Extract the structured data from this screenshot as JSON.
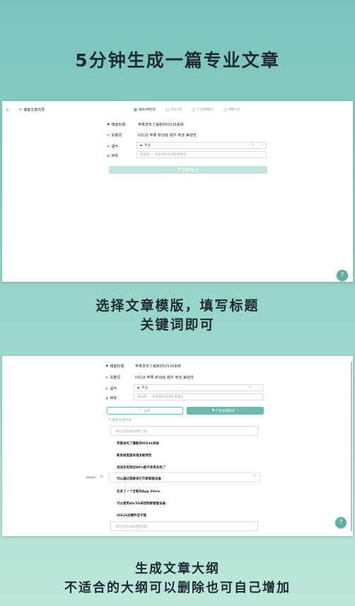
{
  "headline": "5分钟生成一篇专业文章",
  "caption1": [
    "选择文章模版，填写标题",
    "关键词即可"
  ],
  "caption2": [
    "生成文章大纲",
    "不适合的大纲可以删除也可自己增加"
  ],
  "panel1": {
    "logo": "C",
    "app_title": "博客文章向导",
    "steps": [
      "填选详细信息",
      "生成大纲",
      "产生段落要点",
      "博客内容"
    ],
    "fields": {
      "title_label": "博客标题",
      "title_value": "苹果发布了最新的IOS16系统",
      "keywords_label": "关键词",
      "keywords_value": "IOS16 苹果 新功能 组件 电池 兼容性",
      "tone_label": "语气",
      "tone_value": "专业",
      "goal_label": "目标",
      "goal_placeholder": "请选择 — 更多目标选项即将推出"
    },
    "generate_button": "生成大纲"
  },
  "panel2": {
    "fields": {
      "title_label": "博客标题",
      "title_value": "苹果发布了最新的IOS16系统",
      "keywords_label": "关键词",
      "keywords_value": "IOS16 苹果 新功能 组件 电池 兼容性",
      "tone_label": "语气",
      "tone_value": "专业",
      "goal_label": "目标",
      "goal_placeholder": "请选择 — 更多目标选项即将推出"
    },
    "back_button": "返回",
    "next_button": "产生段落要点",
    "regenerate_link": "重新生成列表",
    "input_placeholder": "请在此处添加博客小组",
    "outline_items": [
      "苹果发布了最新的IOS16系统",
      "新系统里面有很多新特性",
      "电池充电到达80%就不会再充电了",
      "可以通过锁屏来打开家智能设备",
      "还多了一个全新的App Store",
      "可以使用4G/5G来控制家智能设备",
      "IOS16对硬件还不错"
    ],
    "section_tag": "Section",
    "bottom_placeholder": "请在此处添加博客标题"
  },
  "help_label": "?"
}
